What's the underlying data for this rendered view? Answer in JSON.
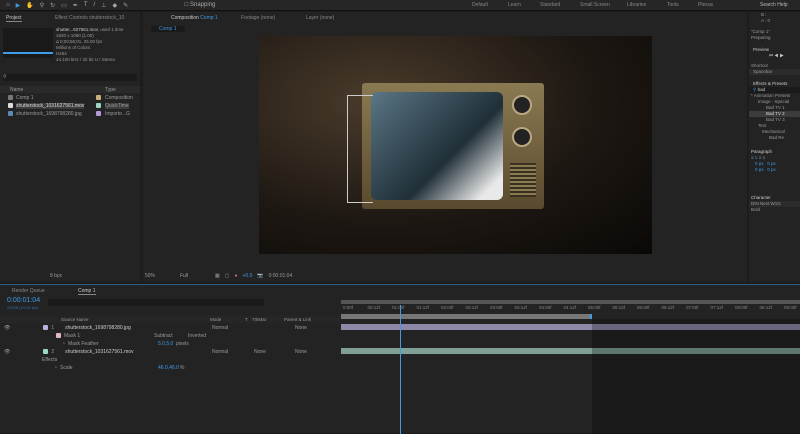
{
  "toolbar": {
    "snapping": "Snapping",
    "tools": [
      "home-icon",
      "selection-icon",
      "hand-icon",
      "zoom-icon",
      "rotate-icon",
      "camera-icon",
      "pan-icon",
      "undo-icon",
      "anchor-icon",
      "rectangle-icon",
      "pen-icon",
      "type-icon",
      "brush-icon",
      "stamp-icon",
      "eraser-icon",
      "roto-icon",
      "pin-icon"
    ]
  },
  "workspaces": [
    "Default",
    "Learn",
    "Standard",
    "Small Screen",
    "Libraries",
    "Tools",
    "Plexus"
  ],
  "search_help": "Search Help",
  "project": {
    "tab": "Project",
    "effect_controls": "Effect Controls shutterstock_10",
    "info": {
      "name": "shutter...627561.mov",
      "used": ", used 1 time",
      "res": "1920 x 1080 (1.00)",
      "dur": "Δ 0;00;56;01, 25.00 fps",
      "colors": "Millions of Colors",
      "codec": "H264",
      "audio": "44.100 kHz / 32 bit U / Stereo"
    },
    "columns": {
      "name": "Name",
      "type": "Type"
    },
    "items": [
      {
        "name": "Comp 1",
        "type": "Composition",
        "color": "#c9b078"
      },
      {
        "name": "shutterstock_1031627561.mov",
        "type": "QuickTime",
        "color": "#9dd7c9"
      },
      {
        "name": "shutterstock_1698798280.jpg",
        "type": "Importe...G",
        "color": "#b49ad6"
      }
    ],
    "bpc": "8 bpc"
  },
  "comp": {
    "tab": "Composition",
    "comp_name": "Comp 1",
    "footage": "Footage (none)",
    "layer": "Layer (none)",
    "subtab": "Comp 1",
    "zoom": "50%",
    "quality": "Full",
    "exposure": "+0.0",
    "timecode": "0:00:01:04"
  },
  "right": {
    "info_b": "B :",
    "info_a": "A : 0",
    "comp_status": "\"Comp 1\"",
    "preparing": "Preparing",
    "preview": "Preview",
    "shortcut_label": "Shortcut",
    "shortcut": "Spacebar",
    "effects": "Effects & Presets",
    "search": "bad",
    "tree": [
      "* Animation Presets",
      "Image - Special",
      "Bad TV 1",
      "Bad TV 2",
      "Bad TV 3",
      "Text",
      "Mechanical",
      "Bad Re"
    ],
    "paragraph": "Paragraph",
    "px": [
      "0 px",
      "0 px",
      "0 px",
      "0 px"
    ],
    "character": "Character",
    "font": "DIN Next W1G",
    "style": "Bold"
  },
  "timeline": {
    "render_queue": "Render Queue",
    "comp_tab": "Comp 1",
    "timecode": "0:00:01:04",
    "frames": "00028 (24.00 fps)",
    "headers": {
      "source": "Source Name",
      "mode": "Mode",
      "t": "T",
      "trkmat": "TrkMat",
      "parent": "Parent & Link"
    },
    "layers": [
      {
        "num": "1",
        "name": "shutterstock_1698798280.jpg",
        "mode": "Normal",
        "trkmat": "",
        "parent": "None",
        "color": "#b7b3dc"
      },
      {
        "num": "2",
        "name": "shutterstock_1031627561.mov",
        "mode": "Normal",
        "trkmat": "None",
        "parent": "None",
        "color": "#9dd7c9"
      }
    ],
    "mask": {
      "name": "Mask 1",
      "mode": "Subtract",
      "inverted": "Inverted",
      "feather_label": "Mask Feather",
      "feather": "5.0,5.0",
      "feather_unit": "pixels"
    },
    "effects": "Effects",
    "scale_label": "Scale",
    "scale": "46.0,46.0",
    "scale_unit": "%",
    "ruler": [
      "0:00f",
      "00:12f",
      "01:00f",
      "01:12f",
      "02:00f",
      "02:12f",
      "03:00f",
      "03:12f",
      "04:00f",
      "04:12f",
      "05:00f",
      "05:12f",
      "06:00f",
      "06:12f",
      "07:00f",
      "07:12f",
      "08:00f",
      "08:12f",
      "09:00f"
    ]
  }
}
